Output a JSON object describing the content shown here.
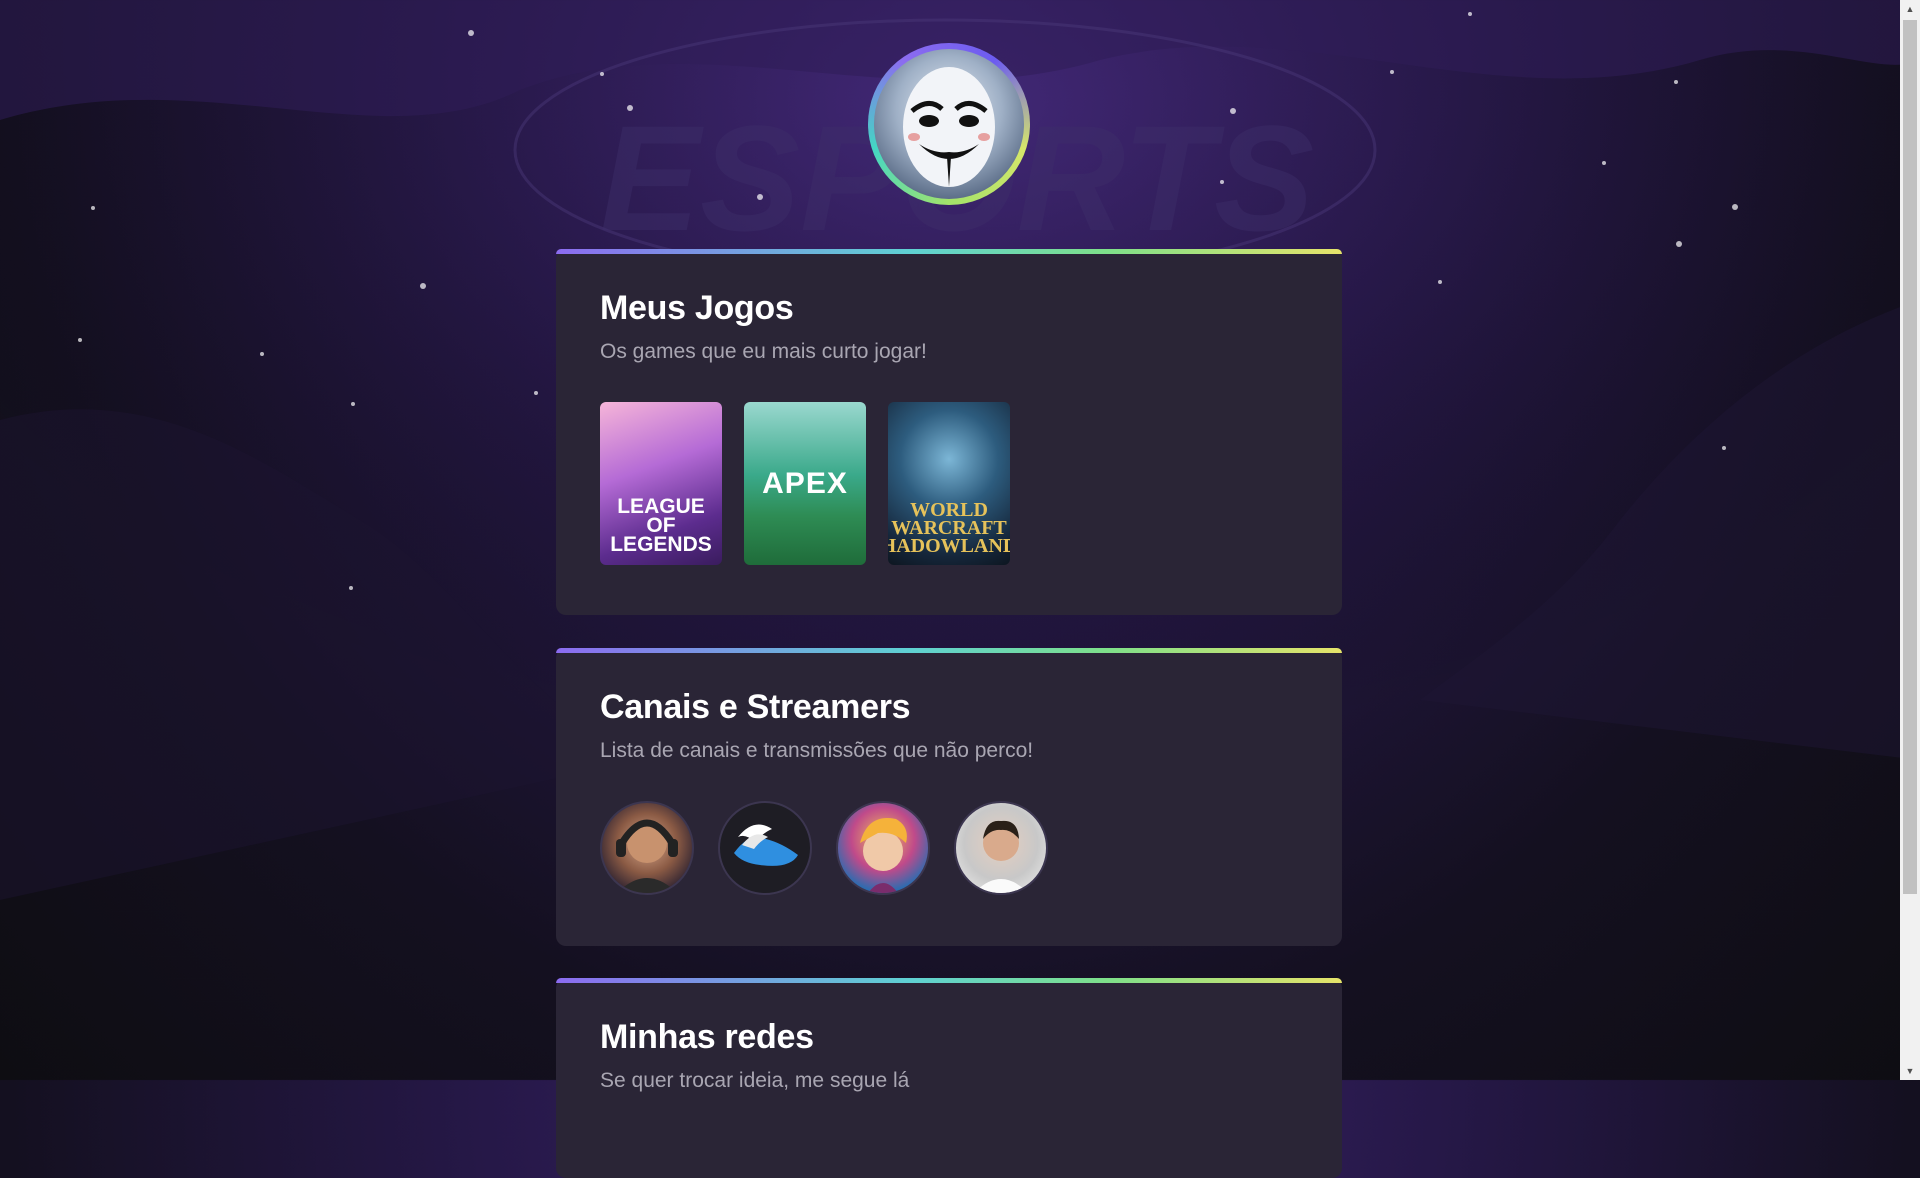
{
  "profile": {
    "avatar_icon": "guy-fawkes-mask-icon"
  },
  "games_section": {
    "title": "Meus Jogos",
    "subtitle": "Os games que eu mais curto jogar!",
    "games": [
      {
        "label": "LEAGUE OF\nLEGENDS",
        "icon": "league-of-legends-cover"
      },
      {
        "label": "APEX",
        "icon": "apex-legends-cover"
      },
      {
        "label": "WORLD\nWARCRAFT\nSHADOWLANDS",
        "icon": "world-of-warcraft-cover"
      }
    ]
  },
  "streamers_section": {
    "title": "Canais e Streamers",
    "subtitle": "Lista de canais e transmissões que não perco!",
    "streamers": [
      {
        "icon": "streamer-headset-avatar"
      },
      {
        "icon": "winged-shoe-logo-avatar"
      },
      {
        "icon": "cartoon-hero-avatar"
      },
      {
        "icon": "streamer-portrait-avatar"
      }
    ]
  },
  "social_section": {
    "title": "Minhas redes",
    "subtitle": "Se quer trocar ideia, me segue lá"
  },
  "colors": {
    "card_bg": "#2a2536",
    "accent_gradient": [
      "#8c6cf0",
      "#5fd1d3",
      "#7ee08a",
      "#e6e46a"
    ],
    "subtitle": "#a9a6b2"
  }
}
